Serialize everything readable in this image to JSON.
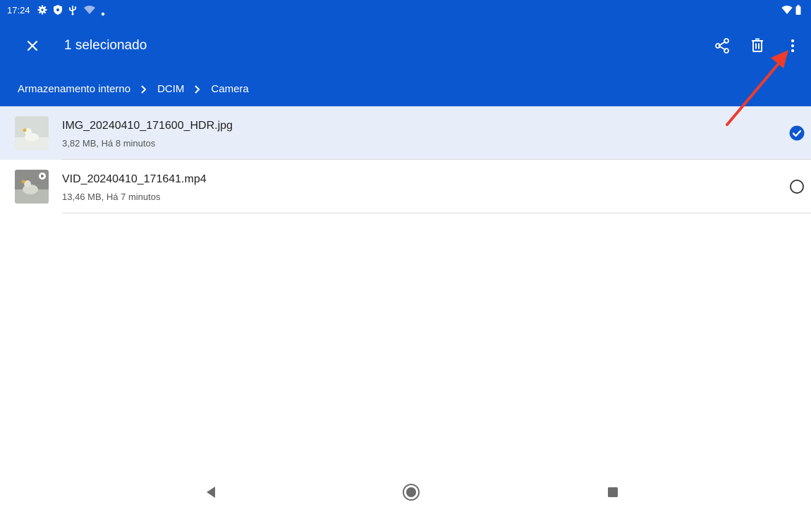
{
  "status_bar": {
    "time": "17:24",
    "left_icons": [
      "settings-icon",
      "shield-icon",
      "usb-icon",
      "wifi-icon",
      "dot-icon"
    ],
    "right_icons": [
      "wifi-icon",
      "battery-icon"
    ]
  },
  "app_bar": {
    "close_icon": "close-icon",
    "selection_title": "1 selecionado",
    "actions": [
      "share-icon",
      "delete-icon",
      "more-vert-icon"
    ]
  },
  "breadcrumb": {
    "items": [
      "Armazenamento interno",
      "DCIM",
      "Camera"
    ],
    "separator_icon": "chevron-right-icon"
  },
  "files": [
    {
      "name": "IMG_20240410_171600_HDR.jpg",
      "meta": "3,82 MB, Há 8 minutos",
      "selected": true,
      "type": "image"
    },
    {
      "name": "VID_20240410_171641.mp4",
      "meta": "13,46 MB, Há 7 minutos",
      "selected": false,
      "type": "video"
    }
  ],
  "nav_bar": {
    "buttons": [
      "back-icon",
      "home-icon",
      "recents-icon"
    ]
  },
  "colors": {
    "app_bar_bg": "#0b57d0",
    "selected_row_bg": "#e8eef9",
    "check_fill": "#0b57d0",
    "annotation_arrow": "#ee3b2c"
  }
}
